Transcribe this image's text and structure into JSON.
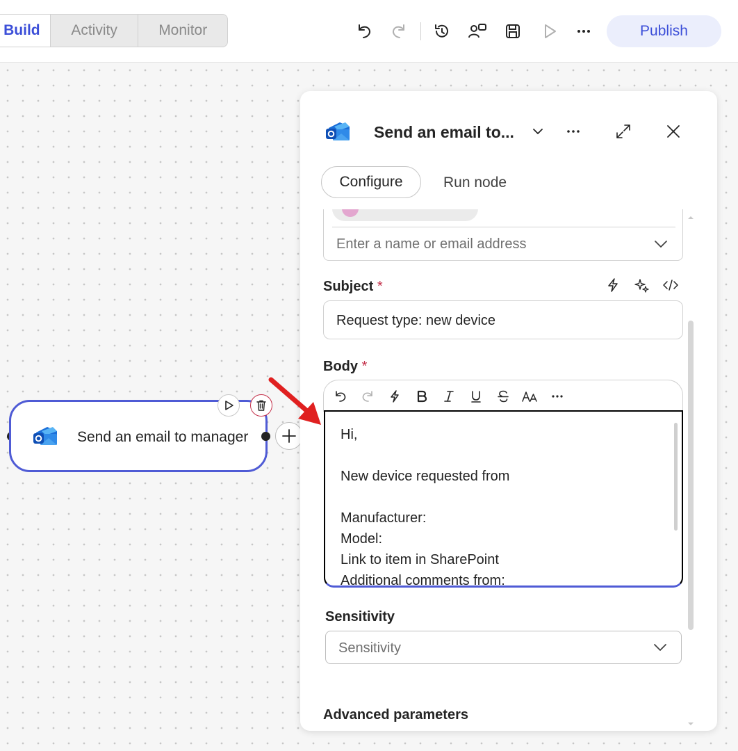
{
  "topbar": {
    "tabs": [
      {
        "label": "Build",
        "active": true
      },
      {
        "label": "Activity",
        "active": false
      },
      {
        "label": "Monitor",
        "active": false
      }
    ],
    "icons": [
      "undo-icon",
      "redo-icon",
      "history-icon",
      "share-icon",
      "save-icon",
      "run-icon",
      "more-icon"
    ],
    "publish_label": "Publish"
  },
  "node": {
    "title": "Send an email to manager",
    "icon": "outlook-icon"
  },
  "panel": {
    "title": "Send an email to...",
    "tabs": {
      "configure": "Configure",
      "run_node": "Run node"
    },
    "to_placeholder": "Enter a name or email address",
    "subject": {
      "label": "Subject",
      "required_mark": "*",
      "value": "Request type: new device"
    },
    "body": {
      "label": "Body",
      "required_mark": "*",
      "lines": [
        "Hi,",
        "",
        "New device requested from",
        "",
        "Manufacturer:",
        "Model:",
        "Link to item in SharePoint",
        "Additional comments from:"
      ]
    },
    "sensitivity": {
      "label": "Sensitivity",
      "placeholder": "Sensitivity"
    },
    "advanced_label": "Advanced parameters"
  },
  "colors": {
    "accent": "#3b4ed8",
    "node_border": "#4f5bd5",
    "required": "#c4314b",
    "annotation_arrow": "#e02020"
  }
}
